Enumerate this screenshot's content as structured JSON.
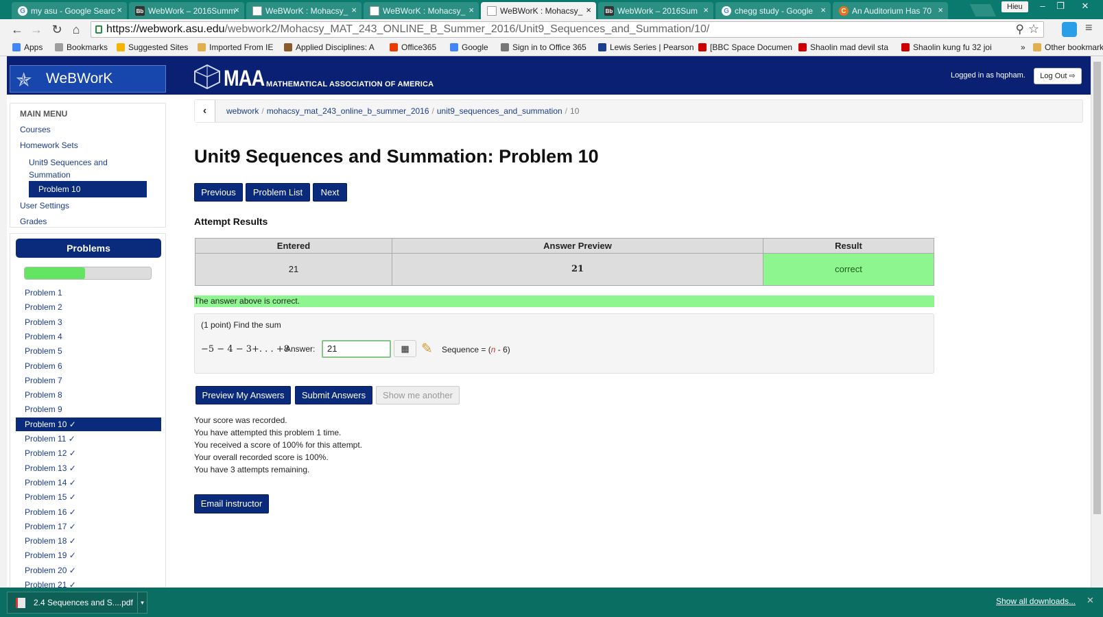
{
  "browser": {
    "tabs": [
      {
        "title": "my asu - Google Searc",
        "icon": "google-icon",
        "active": false
      },
      {
        "title": "WebWork – 2016Summ",
        "icon": "blackboard-icon",
        "active": false
      },
      {
        "title": "WeBWorK : Mohacsy_",
        "icon": "document-icon",
        "active": false
      },
      {
        "title": "WeBWorK : Mohacsy_",
        "icon": "document-icon",
        "active": false
      },
      {
        "title": "WeBWorK : Mohacsy_",
        "icon": "document-icon",
        "active": true
      },
      {
        "title": "WebWork – 2016Sum",
        "icon": "blackboard-icon",
        "active": false
      },
      {
        "title": "chegg study - Google",
        "icon": "google-icon",
        "active": false
      },
      {
        "title": "An Auditorium Has 70",
        "icon": "chegg-icon",
        "active": false
      }
    ],
    "user": "Hieu",
    "url_host": "https://webwork.asu.edu",
    "url_path": "/webwork2/Mohacsy_MAT_243_ONLINE_B_Summer_2016/Unit9_Sequences_and_Summation/10/",
    "bookmarks": [
      {
        "label": "Apps",
        "color": "#4285f4"
      },
      {
        "label": "Bookmarks",
        "color": "#9e9e9e"
      },
      {
        "label": "Suggested Sites",
        "color": "#f4b400"
      },
      {
        "label": "Imported From IE",
        "color": "#e0b050"
      },
      {
        "label": "Applied Disciplines: A",
        "color": "#8a5a2b"
      },
      {
        "label": "Office365",
        "color": "#eb3c00"
      },
      {
        "label": "Google",
        "color": "#4285f4"
      },
      {
        "label": "Sign in to Office 365",
        "color": "#777777"
      },
      {
        "label": "Lewis Series | Pearson",
        "color": "#1a3d8f"
      },
      {
        "label": "[BBC Space Documen",
        "color": "#cc0000"
      },
      {
        "label": "Shaolin mad devil sta",
        "color": "#cc0000"
      },
      {
        "label": "Shaolin kung fu 32 joi",
        "color": "#cc0000"
      },
      {
        "label": "»",
        "color": ""
      },
      {
        "label": "Other bookmarks",
        "color": "#e0b050"
      }
    ]
  },
  "header": {
    "brand": "WeBWorK",
    "maa_big": "MAA",
    "maa_small": "MATHEMATICAL ASSOCIATION OF AMERICA",
    "logged_in": "Logged in as hqpham.",
    "logout": "Log Out"
  },
  "sidebar": {
    "main_menu_title": "MAIN MENU",
    "courses": "Courses",
    "homework_sets": "Homework Sets",
    "set_name": "Unit9 Sequences and Summation",
    "current_problem": "Problem 10",
    "user_settings": "User Settings",
    "grades": "Grades",
    "problems_title": "Problems",
    "progress_percent": 48,
    "problems": [
      {
        "label": "Problem 1",
        "current": false
      },
      {
        "label": "Problem 2",
        "current": false
      },
      {
        "label": "Problem 3",
        "current": false
      },
      {
        "label": "Problem 4",
        "current": false
      },
      {
        "label": "Problem 5",
        "current": false
      },
      {
        "label": "Problem 6",
        "current": false
      },
      {
        "label": "Problem 7",
        "current": false
      },
      {
        "label": "Problem 8",
        "current": false
      },
      {
        "label": "Problem 9",
        "current": false
      },
      {
        "label": "Problem 10 ✓",
        "current": true
      },
      {
        "label": "Problem 11 ✓",
        "current": false
      },
      {
        "label": "Problem 12 ✓",
        "current": false
      },
      {
        "label": "Problem 13 ✓",
        "current": false
      },
      {
        "label": "Problem 14 ✓",
        "current": false
      },
      {
        "label": "Problem 15 ✓",
        "current": false
      },
      {
        "label": "Problem 16 ✓",
        "current": false
      },
      {
        "label": "Problem 17 ✓",
        "current": false
      },
      {
        "label": "Problem 18 ✓",
        "current": false
      },
      {
        "label": "Problem 19 ✓",
        "current": false
      },
      {
        "label": "Problem 20 ✓",
        "current": false
      },
      {
        "label": "Problem 21 ✓",
        "current": false
      }
    ]
  },
  "breadcrumb": {
    "items": [
      "webwork",
      "mohacsy_mat_243_online_b_summer_2016",
      "unit9_sequences_and_summation"
    ],
    "current": "10"
  },
  "main": {
    "title": "Unit9 Sequences and Summation: Problem 10",
    "nav": {
      "previous": "Previous",
      "problem_list": "Problem List",
      "next": "Next"
    },
    "attempt_title": "Attempt Results",
    "table": {
      "headers": [
        "Entered",
        "Answer Preview",
        "Result"
      ],
      "row": {
        "entered": "21",
        "preview": "21",
        "result": "correct"
      }
    },
    "correct_msg": "The answer above is correct.",
    "problem_text": "(1 point) Find the sum",
    "math_expr": "−5 − 4 − 3+. . . +8",
    "answer_label": "Answer:",
    "answer_value": "21",
    "sequence_prefix": "Sequence = (",
    "sequence_var": "n",
    "sequence_suffix": " - 6)",
    "buttons": {
      "preview": "Preview My Answers",
      "submit": "Submit Answers",
      "another": "Show me another"
    },
    "status_lines": [
      "Your score was recorded.",
      "You have attempted this problem 1 time.",
      "You received a score of 100% for this attempt.",
      "Your overall recorded score is 100%.",
      "You have 3 attempts remaining."
    ],
    "email": "Email instructor"
  },
  "downloads": {
    "file": "2.4 Sequences and S....pdf",
    "show_all": "Show all downloads..."
  }
}
